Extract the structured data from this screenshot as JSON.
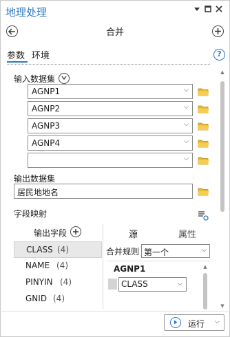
{
  "window": {
    "title": "地理处理"
  },
  "tool": {
    "title": "合并"
  },
  "tabs": [
    {
      "label": "参数"
    },
    {
      "label": "环境"
    }
  ],
  "inputs": {
    "label": "输入数据集",
    "rows": [
      {
        "value": "AGNP1"
      },
      {
        "value": "AGNP2"
      },
      {
        "value": "AGNP3"
      },
      {
        "value": "AGNP4"
      },
      {
        "value": ""
      }
    ]
  },
  "output": {
    "label": "输出数据集",
    "value": "居民地地名"
  },
  "field_map": {
    "label": "字段映射",
    "left_header": "输出字段",
    "fields": [
      {
        "name": "CLASS",
        "count": "(4)"
      },
      {
        "name": "NAME",
        "count": "(4)"
      },
      {
        "name": "PINYIN",
        "count": "(4)"
      },
      {
        "name": "GNID",
        "count": "(4)"
      }
    ],
    "right_tabs": [
      {
        "label": "源"
      },
      {
        "label": "属性"
      }
    ],
    "merge_rule_label": "合并规则",
    "merge_rule_value": "第一个",
    "source_dataset": "AGNP1",
    "source_field": "CLASS"
  },
  "run": {
    "label": "运行"
  },
  "colors": {
    "accent": "#2b78c5",
    "folder": "#e8b731"
  }
}
